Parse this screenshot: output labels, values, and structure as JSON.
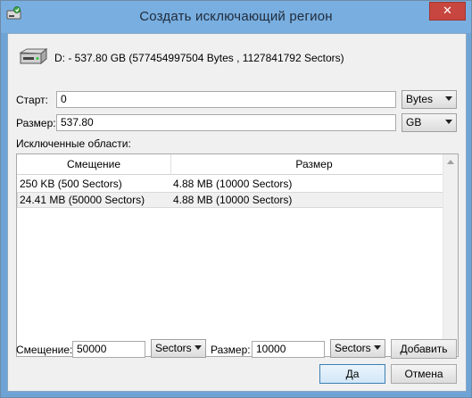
{
  "window": {
    "title": "Создать исключающий регион",
    "close_glyph": "✕"
  },
  "disk": {
    "icon": "hard-drive-icon",
    "info": "D: - 537.80 GB (577454997504 Bytes , 1127841792 Sectors)"
  },
  "start": {
    "label": "Старт:",
    "value": "0",
    "unit": "Bytes"
  },
  "size": {
    "label": "Размер:",
    "value": "537.80",
    "unit": "GB"
  },
  "excluded": {
    "label": "Исключенные области:",
    "columns": [
      "Смещение",
      "Размер"
    ],
    "rows": [
      {
        "offset": "250 KB (500 Sectors)",
        "size": "4.88 MB (10000 Sectors)"
      },
      {
        "offset": "24.41 MB (50000 Sectors)",
        "size": "4.88 MB (10000 Sectors)"
      }
    ]
  },
  "add_region": {
    "offset_label": "Смещение:",
    "offset_value": "50000",
    "offset_unit": "Sectors",
    "size_label": "Размер:",
    "size_value": "10000",
    "size_unit": "Sectors",
    "add_button": "Добавить"
  },
  "buttons": {
    "ok": "Да",
    "cancel": "Отмена"
  }
}
